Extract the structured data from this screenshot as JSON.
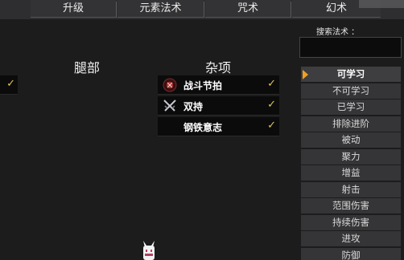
{
  "tabs": [
    {
      "label": "升级"
    },
    {
      "label": "元素法术"
    },
    {
      "label": "咒术"
    },
    {
      "label": "幻术"
    }
  ],
  "columns": {
    "legs": {
      "header": "腿部"
    },
    "misc": {
      "header": "杂项"
    }
  },
  "left_row_check": "✓",
  "misc_skills": [
    {
      "name": "战斗节拍",
      "icon": "battle-rhythm-icon",
      "check": "✓"
    },
    {
      "name": "双持",
      "icon": "crossed-swords-icon",
      "check": "✓"
    },
    {
      "name": "钢铁意志",
      "icon": "none",
      "check": "✓"
    }
  ],
  "search": {
    "label": "搜索法术 ："
  },
  "filters": [
    {
      "label": "可学习",
      "active": true
    },
    {
      "label": "不可学习"
    },
    {
      "label": "已学习"
    },
    {
      "label": "排除进阶"
    },
    {
      "label": "被动"
    },
    {
      "label": "聚力"
    },
    {
      "label": "增益"
    },
    {
      "label": "射击"
    },
    {
      "label": "范围伤害"
    },
    {
      "label": "持续伤害"
    },
    {
      "label": "进攻"
    },
    {
      "label": "防御"
    }
  ],
  "colors": {
    "accent_arrow": "#f0a020",
    "check": "#e0c15a",
    "background": "#1c1c1d"
  }
}
